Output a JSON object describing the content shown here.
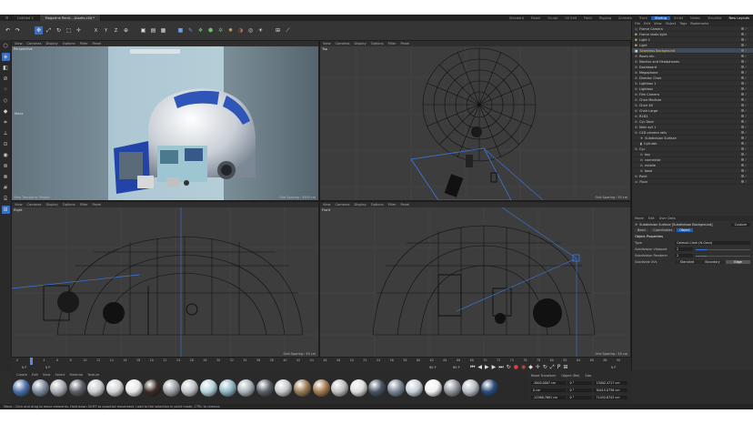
{
  "titlebar": {
    "tabs": [
      "Untitled 2",
      "Magazine Rend....Assets.c4d *"
    ],
    "layouts": [
      "Standard",
      "Model",
      "Sculpt",
      "UV Edit",
      "Paint",
      "Rigging",
      "Animate",
      "Track",
      "Startup",
      "Script",
      "Nodes",
      "Visualize"
    ],
    "active_layout": "Startup",
    "new_layouts": "New Layouts"
  },
  "viewports": {
    "menu": [
      "View",
      "Cameras",
      "Display",
      "Options",
      "Filter",
      "Panel"
    ],
    "perspective": {
      "name": "Perspective",
      "footer_left": "View Transform: Project",
      "footer_right": "Grid Spacing : 5000 cm",
      "move": "Move"
    },
    "top": {
      "name": "Top",
      "footer_right": "Grid Spacing : 50 cm"
    },
    "right": {
      "name": "Right",
      "footer_right": "Grid Spacing : 50 cm"
    },
    "front": {
      "name": "Front",
      "footer_right": "Grid Spacing : 50 cm"
    }
  },
  "timeline": {
    "ticks": [
      "0",
      "2",
      "4",
      "6",
      "8",
      "10",
      "12",
      "14",
      "16",
      "18",
      "20",
      "22",
      "24",
      "26",
      "28",
      "30",
      "32",
      "34",
      "36",
      "38",
      "40",
      "42",
      "44",
      "46",
      "48",
      "50",
      "52",
      "54",
      "56",
      "58",
      "60",
      "62",
      "64",
      "66",
      "68",
      "70",
      "72",
      "74",
      "76",
      "78",
      "80",
      "82",
      "84",
      "86",
      "88",
      "90"
    ],
    "start": "0 F",
    "current": "0 F",
    "end": "90 F",
    "end2": "90 F",
    "frame_display": "0 F"
  },
  "material_menu": [
    "Create",
    "Edit",
    "View",
    "Select",
    "Material",
    "Texture"
  ],
  "materials": [
    "#4a6fa8",
    "#7d8a9c",
    "#a8adb5",
    "#5c6166",
    "#c9ccd0",
    "#d2d4d6",
    "#e6e7e8",
    "#3b2b26",
    "#9aa0a6",
    "#c0c4c8",
    "#b7d3dc",
    "#8fb6c4",
    "#aab3ba",
    "#5a6068",
    "#c5c8cb",
    "#9b7a55",
    "#a47b4f",
    "#bfbfbf",
    "#dcdcdc",
    "#4a5664",
    "#798694",
    "#c7cfd6",
    "#f2f2f2",
    "#8d9299",
    "#b5bbc1",
    "#2b4a7a"
  ],
  "coord": {
    "header": [
      "Reset Transform",
      "Object (Rel)",
      "Size"
    ],
    "rows": [
      {
        "label": "",
        "pos": "-3000.0007 cm",
        "rot": "0 °",
        "size": "13002.4717 cm"
      },
      {
        "label": "",
        "pos": "0 cm",
        "rot": "0 °",
        "size": "50415.0738 cm"
      },
      {
        "label": "",
        "pos": "-13368.7691 cm",
        "rot": "0 °",
        "size": "71452.8743 cm"
      }
    ]
  },
  "objmgr": {
    "menu": [
      "File",
      "Edit",
      "View",
      "Object",
      "Tags",
      "Bookmarks"
    ],
    "items": [
      {
        "name": "Frame Camera",
        "icon": "camera-icon"
      },
      {
        "name": "Frame shots light",
        "icon": "light-icon"
      },
      {
        "name": "Light 1",
        "icon": "light-icon"
      },
      {
        "name": "Light",
        "icon": "light-icon"
      },
      {
        "name": "Seamless Background",
        "icon": "cube-icon",
        "sel": true
      },
      {
        "name": "Room etc.",
        "icon": "null-icon"
      },
      {
        "name": "Monitor and Headphones",
        "icon": "null-icon"
      },
      {
        "name": "Dashboard",
        "icon": "null-icon"
      },
      {
        "name": "Megaphone",
        "icon": "null-icon"
      },
      {
        "name": "Director Chair",
        "icon": "null-icon"
      },
      {
        "name": "Lightbox 1",
        "icon": "null-icon"
      },
      {
        "name": "Lightbox",
        "icon": "null-icon"
      },
      {
        "name": "Film Camera",
        "icon": "null-icon"
      },
      {
        "name": "Chair Medium",
        "icon": "null-icon"
      },
      {
        "name": "Chair 48",
        "icon": "null-icon"
      },
      {
        "name": "Chair Large",
        "icon": "null-icon"
      },
      {
        "name": "R2D2",
        "icon": "null-icon"
      },
      {
        "name": "Cyc Door",
        "icon": "null-icon"
      },
      {
        "name": "Main ayt 1",
        "icon": "null-icon"
      },
      {
        "name": "C4D camera rails",
        "icon": "null-icon"
      },
      {
        "name": "Subdivision Surface",
        "icon": "subdiv-icon"
      },
      {
        "name": "Cylinder",
        "icon": "cylinder-icon"
      },
      {
        "name": "Cyc",
        "icon": "null-icon"
      },
      {
        "name": "top",
        "icon": "null-icon"
      },
      {
        "name": "connector",
        "icon": "null-icon"
      },
      {
        "name": "middle",
        "icon": "null-icon"
      },
      {
        "name": "base",
        "icon": "null-icon"
      },
      {
        "name": "Point",
        "icon": "null-icon"
      },
      {
        "name": "Floor",
        "icon": "floor-icon"
      }
    ]
  },
  "attrmgr": {
    "menu": [
      "Mode",
      "Edit",
      "User Data"
    ],
    "title": "Subdivision Surface [Subdivision Background]",
    "preset": "Custom",
    "tabs": [
      "Basic",
      "Coordinates",
      "Object"
    ],
    "active_tab": "Object",
    "section": "Object Properties",
    "props": [
      {
        "label": "Type",
        "value": "Catmull-Clark (N-Gons)"
      },
      {
        "label": "Subdivision Viewport",
        "value": "2"
      },
      {
        "label": "Subdivision Renderer",
        "value": "2"
      },
      {
        "label": "Subdivide UVs",
        "value": "Standard"
      }
    ],
    "uv_options": [
      "Standard",
      "Boundary",
      "Edge"
    ],
    "uv_selected": "Edge"
  },
  "status": "Move : Click and drag to move elements. Hold down SHIFT to quantize movement / add to the selection in point mode, CTRL to remove."
}
